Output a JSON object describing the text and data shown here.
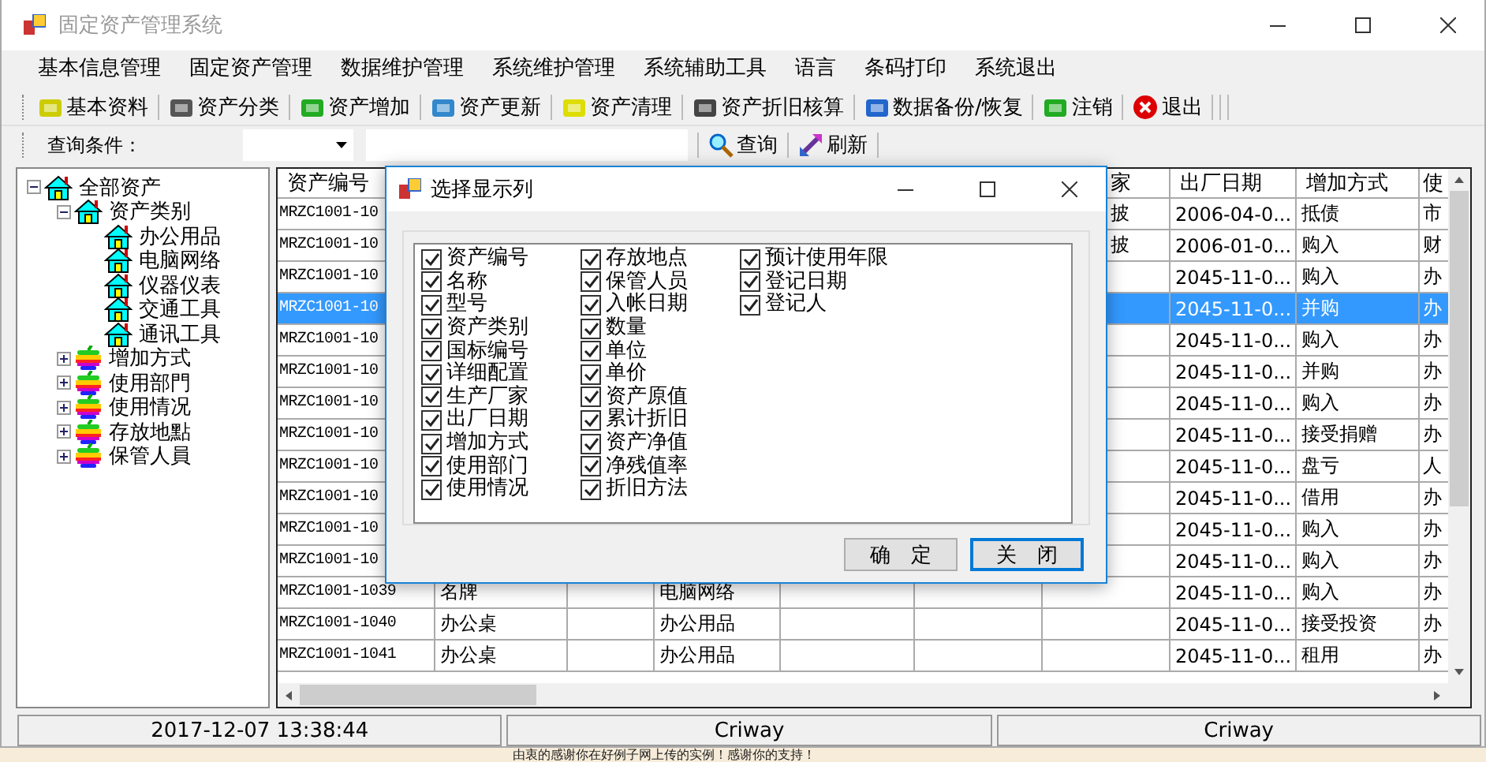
{
  "window": {
    "title": "固定资产管理系统"
  },
  "menu": [
    "基本信息管理",
    "固定资产管理",
    "数据维护管理",
    "系统维护管理",
    "系统辅助工具",
    "语言",
    "条码打印",
    "系统退出"
  ],
  "toolbar": [
    {
      "label": "基本资料"
    },
    {
      "label": "资产分类"
    },
    {
      "label": "资产增加"
    },
    {
      "label": "资产更新"
    },
    {
      "label": "资产清理"
    },
    {
      "label": "资产折旧核算"
    },
    {
      "label": "数据备份/恢复"
    },
    {
      "label": "注销"
    },
    {
      "label": "退出"
    }
  ],
  "query": {
    "label": "查询条件：",
    "buttons": [
      "查询",
      "刷新"
    ]
  },
  "tree": [
    {
      "label": "全部资产",
      "kind": "house",
      "expanded": true,
      "children": [
        {
          "label": "资产类别",
          "kind": "house",
          "expanded": true,
          "children": [
            {
              "label": "办公用品",
              "kind": "house"
            },
            {
              "label": "电脑网络",
              "kind": "house"
            },
            {
              "label": "仪器仪表",
              "kind": "house"
            },
            {
              "label": "交通工具",
              "kind": "house"
            },
            {
              "label": "通讯工具",
              "kind": "house"
            }
          ]
        },
        {
          "label": "增加方式",
          "kind": "apple",
          "expanded": false
        },
        {
          "label": "使用部門",
          "kind": "apple",
          "expanded": false
        },
        {
          "label": "使用情况",
          "kind": "apple",
          "expanded": false
        },
        {
          "label": "存放地點",
          "kind": "apple",
          "expanded": false
        },
        {
          "label": "保管人員",
          "kind": "apple",
          "expanded": false
        }
      ]
    }
  ],
  "table": {
    "columns": {
      "column_1": "资产编号",
      "column_7": "家",
      "column_8": "出厂日期",
      "column_9": "增加方式",
      "column_10": "使"
    },
    "rows": [
      {
        "selected": false,
        "column_1": "MRZC1001-10",
        "column_7": "披",
        "column_8": "2006-04-0...",
        "column_9": "抵债",
        "column_10": "市"
      },
      {
        "selected": false,
        "column_1": "MRZC1001-10",
        "column_7": "披",
        "column_8": "2006-01-0...",
        "column_9": "购入",
        "column_10": "财"
      },
      {
        "selected": false,
        "column_1": "MRZC1001-10",
        "column_8": "2045-11-0...",
        "column_9": "购入",
        "column_10": "办"
      },
      {
        "selected": true,
        "column_1": "MRZC1001-10",
        "column_8": "2045-11-0...",
        "column_9": "并购",
        "column_10": "办"
      },
      {
        "selected": false,
        "column_1": "MRZC1001-10",
        "column_8": "2045-11-0...",
        "column_9": "购入",
        "column_10": "办"
      },
      {
        "selected": false,
        "column_1": "MRZC1001-10",
        "column_8": "2045-11-0...",
        "column_9": "并购",
        "column_10": "办"
      },
      {
        "selected": false,
        "column_1": "MRZC1001-10",
        "column_8": "2045-11-0...",
        "column_9": "购入",
        "column_10": "办"
      },
      {
        "selected": false,
        "column_1": "MRZC1001-10",
        "column_8": "2045-11-0...",
        "column_9": "接受捐赠",
        "column_10": "办"
      },
      {
        "selected": false,
        "column_1": "MRZC1001-10",
        "column_8": "2045-11-0...",
        "column_9": "盘亏",
        "column_10": "人"
      },
      {
        "selected": false,
        "column_1": "MRZC1001-10",
        "column_8": "2045-11-0...",
        "column_9": "借用",
        "column_10": "办"
      },
      {
        "selected": false,
        "column_1": "MRZC1001-10",
        "column_8": "2045-11-0...",
        "column_9": "购入",
        "column_10": "办"
      },
      {
        "selected": false,
        "column_1": "MRZC1001-10",
        "column_8": "2045-11-0...",
        "column_9": "购入",
        "column_10": "办"
      },
      {
        "selected": false,
        "column_1": "MRZC1001-1039",
        "column_2": "名牌",
        "column_4": "电脑网络",
        "column_8": "2045-11-0...",
        "column_9": "购入",
        "column_10": "办"
      },
      {
        "selected": false,
        "column_1": "MRZC1001-1040",
        "column_2": "办公桌",
        "column_4": "办公用品",
        "column_8": "2045-11-0...",
        "column_9": "接受投资",
        "column_10": "办"
      },
      {
        "selected": false,
        "column_1": "MRZC1001-1041",
        "column_2": "办公桌",
        "column_4": "办公用品",
        "column_8": "2045-11-0...",
        "column_9": "租用",
        "column_10": "办"
      }
    ]
  },
  "dialog": {
    "title": "选择显示列",
    "options": [
      {
        "label": "资产编号",
        "checked": true
      },
      {
        "label": "名称",
        "checked": true
      },
      {
        "label": "型号",
        "checked": true
      },
      {
        "label": "资产类别",
        "checked": true
      },
      {
        "label": "国标编号",
        "checked": true
      },
      {
        "label": "详细配置",
        "checked": true
      },
      {
        "label": "生产厂家",
        "checked": true
      },
      {
        "label": "出厂日期",
        "checked": true
      },
      {
        "label": "增加方式",
        "checked": true
      },
      {
        "label": "使用部门",
        "checked": true
      },
      {
        "label": "使用情况",
        "checked": true
      },
      {
        "label": "存放地点",
        "checked": true
      },
      {
        "label": "保管人员",
        "checked": true
      },
      {
        "label": "入帐日期",
        "checked": true
      },
      {
        "label": "数量",
        "checked": true
      },
      {
        "label": "单位",
        "checked": true
      },
      {
        "label": "单价",
        "checked": true
      },
      {
        "label": "资产原值",
        "checked": true
      },
      {
        "label": "累计折旧",
        "checked": true
      },
      {
        "label": "资产净值",
        "checked": true
      },
      {
        "label": "净残值率",
        "checked": true
      },
      {
        "label": "折旧方法",
        "checked": true
      },
      {
        "label": "预计使用年限",
        "checked": true
      },
      {
        "label": "登记日期",
        "checked": true
      },
      {
        "label": "登记人",
        "checked": true
      }
    ],
    "buttons": [
      {
        "label": "确　定",
        "focused": false
      },
      {
        "label": "关　闭",
        "focused": true
      }
    ]
  },
  "status_bar": [
    "2017-12-07 13:38:44",
    "Criway",
    "Criway"
  ],
  "footer_note": "由衷的感谢你在好例子网上传的实例！感谢你的支持！"
}
